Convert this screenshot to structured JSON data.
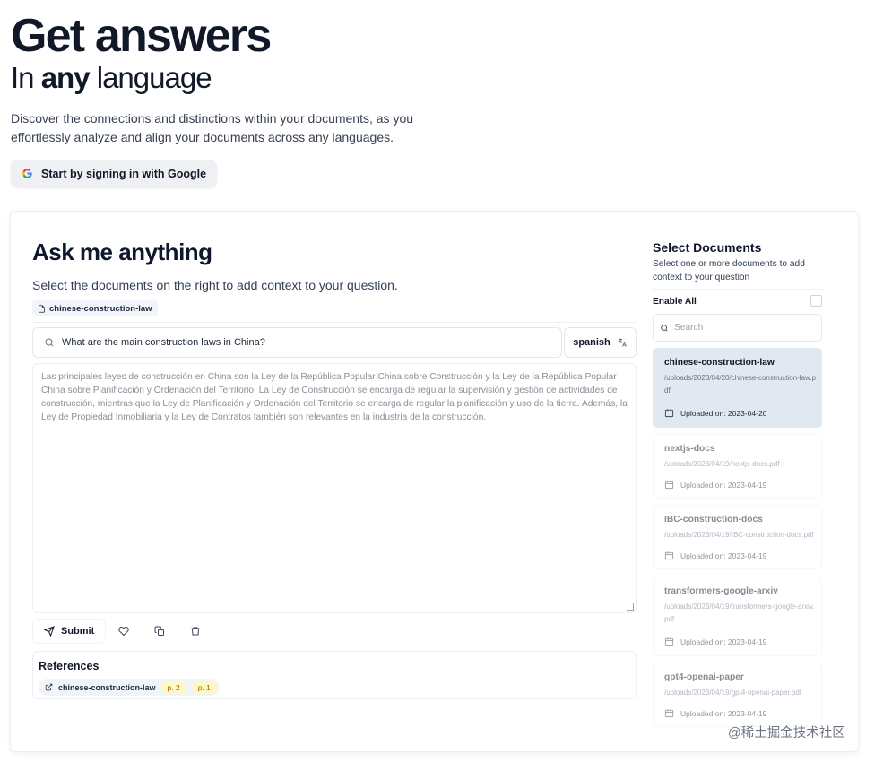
{
  "hero": {
    "title": "Get answers",
    "subtitle_prefix": "In ",
    "subtitle_bold": "any",
    "subtitle_suffix": " language",
    "description": "Discover the connections and distinctions within your documents, as you effortlessly analyze and align your documents across any languages.",
    "signin_label": "Start by signing in with Google"
  },
  "ask": {
    "title": "Ask me anything",
    "subtitle": "Select the documents on the right to add context to your question.",
    "selected_doc": "chinese-construction-law",
    "question": "What are the main construction laws in China?",
    "language": "spanish",
    "answer": "Las principales leyes de construcción en China son la Ley de la República Popular China sobre Construcción y la Ley de la República Popular China sobre Planificación y Ordenación del Territorio. La Ley de Construcción se encarga de regular la supervisión y gestión de actividades de construcción, mientras que la Ley de Planificación y Ordenación del Territorio se encarga de regular la planificación y uso de la tierra. Además, la Ley de Propiedad Inmobiliaria y la Ley de Contratos también son relevantes en la industria de la construcción.",
    "submit_label": "Submit"
  },
  "references": {
    "title": "References",
    "doc": "chinese-construction-law",
    "pages": [
      "p. 2",
      "p. 1"
    ]
  },
  "sidebar": {
    "title": "Select Documents",
    "subtitle": "Select one or more documents to add context to your question",
    "enable_all_label": "Enable All",
    "search_placeholder": "Search",
    "docs": [
      {
        "name": "chinese-construction-law",
        "path": "/uploads/2023/04/20/chinese-construction-law.pdf",
        "date": "Uploaded on: 2023-04-20"
      },
      {
        "name": "nextjs-docs",
        "path": "/uploads/2023/04/19/nextjs-docs.pdf",
        "date": "Uploaded on: 2023-04-19"
      },
      {
        "name": "IBC-construction-docs",
        "path": "/uploads/2023/04/19/IBC-construction-docs.pdf",
        "date": "Uploaded on: 2023-04-19"
      },
      {
        "name": "transformers-google-arxiv",
        "path": "/uploads/2023/04/19/transformers-google-arxiv.pdf",
        "date": "Uploaded on: 2023-04-19"
      },
      {
        "name": "gpt4-openai-paper",
        "path": "/uploads/2023/04/19/gpt4-openai-paper.pdf",
        "date": "Uploaded on: 2023-04-19"
      }
    ]
  },
  "watermark": "@稀土掘金技术社区",
  "colors": {
    "active_doc_bg": "#e2e8f0",
    "page_badge_bg": "#fef9c3",
    "page_badge_text": "#a16207"
  }
}
